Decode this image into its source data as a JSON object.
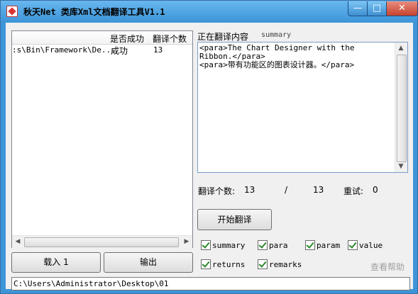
{
  "window": {
    "title": "秋天Net 类库Xml文档翻译工具V1.1",
    "min_glyph": "—",
    "max_glyph": "□",
    "close_glyph": "✕"
  },
  "list": {
    "columns": [
      "是否成功",
      "翻译个数"
    ],
    "rows": [
      {
        "path": ":s\\Bin\\Framework\\De...",
        "success": "成功",
        "count": "13"
      }
    ]
  },
  "buttons": {
    "load": "载入 1",
    "output": "输出",
    "start": "开始翻译"
  },
  "path_value": "C:\\Users\\Administrator\\Desktop\\01",
  "translating": {
    "label": "正在翻译内容",
    "element": "summary",
    "content": "<para>The Chart Designer with the\nRibbon.</para>\n<para>带有功能区的图表设计器。</para>"
  },
  "stats": {
    "count_label": "翻译个数:",
    "done": "13",
    "separator": "/",
    "total": "13",
    "retry_label": "重试:",
    "retry": "0"
  },
  "options": [
    {
      "label": "summary",
      "checked": true
    },
    {
      "label": "para",
      "checked": true
    },
    {
      "label": "param",
      "checked": true
    },
    {
      "label": "value",
      "checked": true
    },
    {
      "label": "returns",
      "checked": true
    },
    {
      "label": "remarks",
      "checked": true
    }
  ],
  "help_link": "查看帮助"
}
